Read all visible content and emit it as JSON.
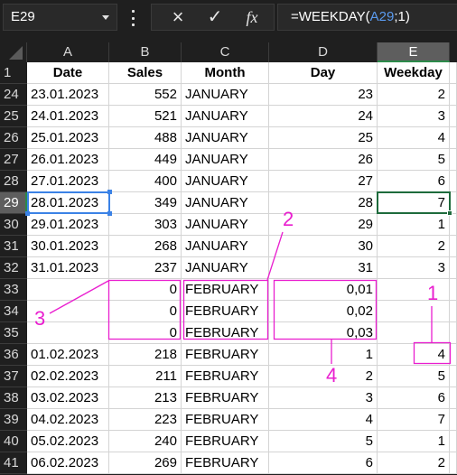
{
  "formula_bar": {
    "name_box": "E29",
    "formula_prefix": "=WEEKDAY(",
    "formula_ref": "A29",
    "formula_suffix": ";1)",
    "cancel_icon": "×",
    "enter_icon": "✓",
    "function_icon": "fx"
  },
  "columns": [
    "A",
    "B",
    "C",
    "D",
    "E"
  ],
  "selected_column": "E",
  "header_row": {
    "row_number": "1",
    "cells": [
      "Date",
      "Sales",
      "Month",
      "Day",
      "Weekday"
    ]
  },
  "rows": [
    {
      "n": "24",
      "date": "23.01.2023",
      "sales": "552",
      "month": "JANUARY",
      "day": "23",
      "weekday": "2"
    },
    {
      "n": "25",
      "date": "24.01.2023",
      "sales": "521",
      "month": "JANUARY",
      "day": "24",
      "weekday": "3"
    },
    {
      "n": "26",
      "date": "25.01.2023",
      "sales": "488",
      "month": "JANUARY",
      "day": "25",
      "weekday": "4"
    },
    {
      "n": "27",
      "date": "26.01.2023",
      "sales": "449",
      "month": "JANUARY",
      "day": "26",
      "weekday": "5"
    },
    {
      "n": "28",
      "date": "27.01.2023",
      "sales": "400",
      "month": "JANUARY",
      "day": "27",
      "weekday": "6"
    },
    {
      "n": "29",
      "date": "28.01.2023",
      "sales": "349",
      "month": "JANUARY",
      "day": "28",
      "weekday": "7"
    },
    {
      "n": "30",
      "date": "29.01.2023",
      "sales": "303",
      "month": "JANUARY",
      "day": "29",
      "weekday": "1"
    },
    {
      "n": "31",
      "date": "30.01.2023",
      "sales": "268",
      "month": "JANUARY",
      "day": "30",
      "weekday": "2"
    },
    {
      "n": "32",
      "date": "31.01.2023",
      "sales": "237",
      "month": "JANUARY",
      "day": "31",
      "weekday": "3"
    },
    {
      "n": "33",
      "date": "",
      "sales": "0",
      "month": "FEBRUARY",
      "day": "0,01",
      "weekday": ""
    },
    {
      "n": "34",
      "date": "",
      "sales": "0",
      "month": "FEBRUARY",
      "day": "0,02",
      "weekday": ""
    },
    {
      "n": "35",
      "date": "",
      "sales": "0",
      "month": "FEBRUARY",
      "day": "0,03",
      "weekday": ""
    },
    {
      "n": "36",
      "date": "01.02.2023",
      "sales": "218",
      "month": "FEBRUARY",
      "day": "1",
      "weekday": "4"
    },
    {
      "n": "37",
      "date": "02.02.2023",
      "sales": "211",
      "month": "FEBRUARY",
      "day": "2",
      "weekday": "5"
    },
    {
      "n": "38",
      "date": "03.02.2023",
      "sales": "213",
      "month": "FEBRUARY",
      "day": "3",
      "weekday": "6"
    },
    {
      "n": "39",
      "date": "04.02.2023",
      "sales": "223",
      "month": "FEBRUARY",
      "day": "4",
      "weekday": "7"
    },
    {
      "n": "40",
      "date": "05.02.2023",
      "sales": "240",
      "month": "FEBRUARY",
      "day": "5",
      "weekday": "1"
    },
    {
      "n": "41",
      "date": "06.02.2023",
      "sales": "269",
      "month": "FEBRUARY",
      "day": "6",
      "weekday": "2"
    }
  ],
  "selected_row": "29",
  "annotations": {
    "color": "#e91ecf",
    "labels": [
      "1",
      "2",
      "3",
      "4"
    ]
  }
}
